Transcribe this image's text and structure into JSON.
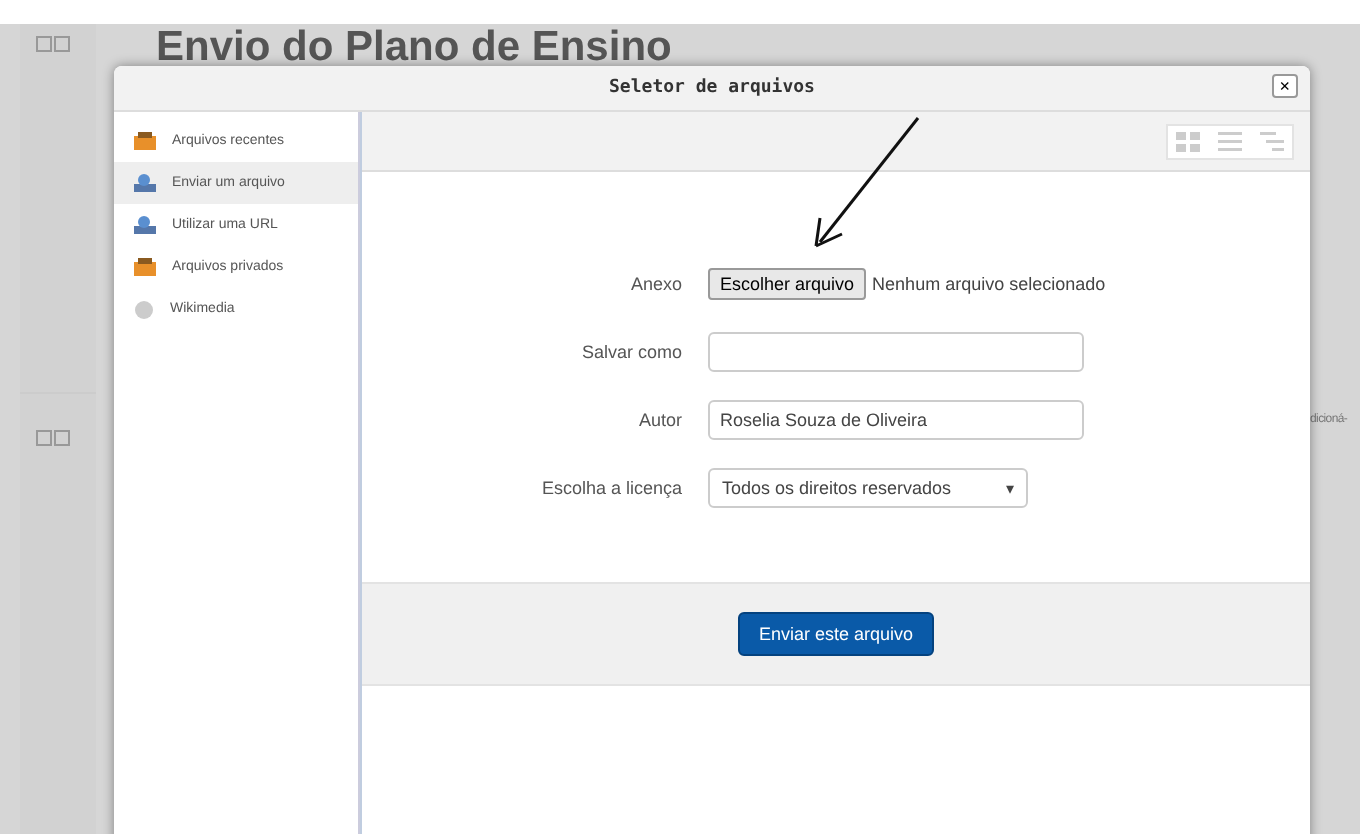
{
  "page": {
    "title": "Envio do Plano de Ensino",
    "background_text": "dicioná-"
  },
  "dialog": {
    "title": "Seletor de arquivos",
    "close": "×",
    "sidebar": {
      "items": [
        {
          "label": "Arquivos recentes",
          "kind": "folder",
          "selected": false
        },
        {
          "label": "Enviar um arquivo",
          "kind": "upload",
          "selected": true
        },
        {
          "label": "Utilizar uma URL",
          "kind": "upload",
          "selected": false
        },
        {
          "label": "Arquivos privados",
          "kind": "folder",
          "selected": false
        },
        {
          "label": "Wikimedia",
          "kind": "globe",
          "selected": false
        }
      ]
    },
    "form": {
      "rows": [
        {
          "kind": "file",
          "label": "Anexo",
          "button": "Escolher arquivo",
          "value": "Nenhum arquivo selecionado"
        },
        {
          "kind": "text",
          "label": "Salvar como",
          "value": ""
        },
        {
          "kind": "text",
          "label": "Autor",
          "value": "Roselia Souza de Oliveira"
        },
        {
          "kind": "select",
          "label": "Escolha a licença",
          "value": "Todos os direitos reservados",
          "caret": "▾"
        }
      ]
    },
    "submit": "Enviar este arquivo"
  }
}
